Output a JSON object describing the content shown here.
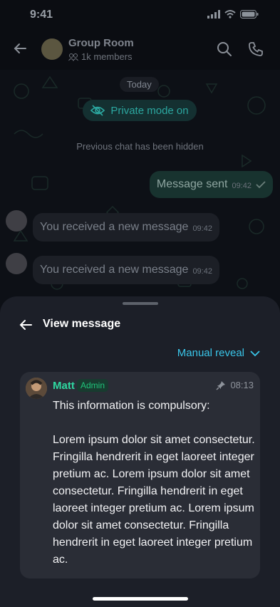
{
  "status": {
    "time": "9:41"
  },
  "header": {
    "title": "Group Room",
    "subtitle": "1k members"
  },
  "chat": {
    "date_label": "Today",
    "private_label": "Private mode on",
    "hidden_note": "Previous chat has been hidden",
    "outgoing": {
      "text": "Message sent",
      "time": "09:42"
    },
    "incoming": [
      {
        "text": "You received a new message",
        "time": "09:42"
      },
      {
        "text": "You received a new message",
        "time": "09:42"
      }
    ]
  },
  "sheet": {
    "title": "View message",
    "reveal_label": "Manual reveal",
    "message": {
      "sender": "Matt",
      "badge": "Admin",
      "time": "08:13",
      "body": "This information is compulsory:\n\nLorem ipsum dolor sit amet consectetur. Fringilla hendrerit in eget laoreet integer pretium ac. Lorem ipsum dolor sit amet consectetur. Fringilla hendrerit in eget laoreet integer pretium ac. Lorem ipsum dolor sit amet consectetur. Fringilla hendrerit in eget laoreet integer pretium ac."
    }
  },
  "colors": {
    "accent": "#3ac6ea",
    "sender": "#2fd8a1",
    "sheet_bg": "#1c1f28",
    "card_bg": "#2a2d36"
  }
}
